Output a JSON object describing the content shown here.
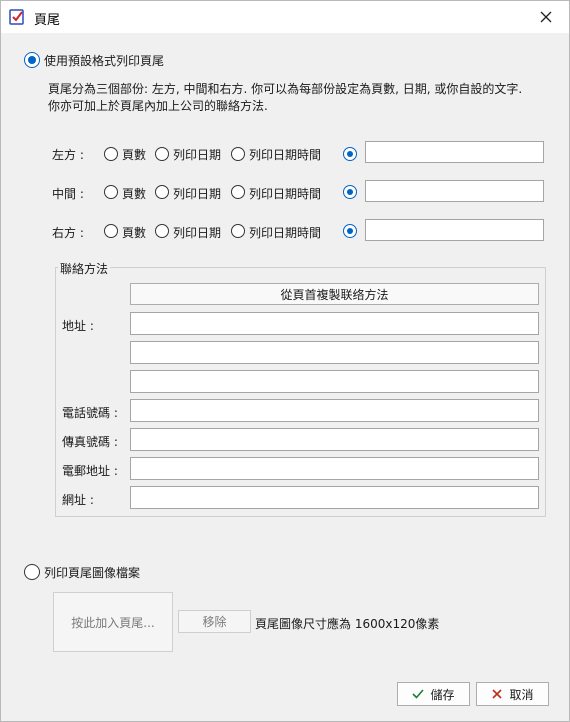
{
  "window": {
    "title": "頁尾"
  },
  "default_format": {
    "label": "使用預設格式列印頁尾",
    "desc_line1": "頁尾分為三個部份: 左方, 中間和右方. 你可以為每部份設定為頁數, 日期, 或你自設的文字.",
    "desc_line2": "你亦可加上於頁尾內加上公司的聯絡方法.",
    "rows": [
      {
        "label": "左方 :",
        "opt_page": "頁數",
        "opt_date": "列印日期",
        "opt_datetime": "列印日期時間",
        "custom_value": ""
      },
      {
        "label": "中間 :",
        "opt_page": "頁數",
        "opt_date": "列印日期",
        "opt_datetime": "列印日期時間",
        "custom_value": ""
      },
      {
        "label": "右方 :",
        "opt_page": "頁數",
        "opt_date": "列印日期",
        "opt_datetime": "列印日期時間",
        "custom_value": ""
      }
    ]
  },
  "contact": {
    "title": "聯絡方法",
    "copy_button": "從頁首複製联络方法",
    "address_label": "地址 :",
    "phone_label": "電話號碼 :",
    "fax_label": "傳真號碼 :",
    "email_label": "電郵地址 :",
    "website_label": "網址 :"
  },
  "image_option": {
    "label": "列印頁尾圖像檔案",
    "add_button": "按此加入頁尾...",
    "remove_button": "移除",
    "size_hint": "頁尾圖像尺寸應為 1600x120像素"
  },
  "footer": {
    "save_label": "儲存",
    "cancel_label": "取消"
  },
  "colors": {
    "accent": "#0063c6",
    "cancel_icon": "#c42b1c",
    "save_icon": "#1e7d32"
  }
}
